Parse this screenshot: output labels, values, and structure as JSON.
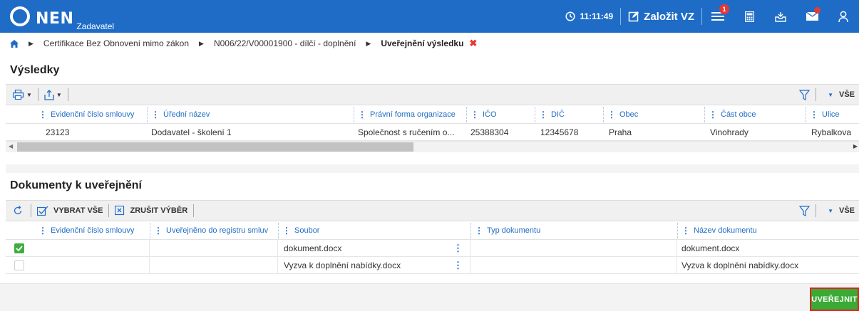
{
  "app": {
    "logo_text": "NEN",
    "logo_sub": "Zadavatel",
    "time": "11:11:49",
    "create_label": "Založit VZ",
    "menu_badge": "1",
    "accent_color": "#1f6cc7"
  },
  "breadcrumb": {
    "items": [
      "Certifikace Bez Obnovení mimo zákon",
      "N006/22/V00001900 - dílčí - doplnění"
    ],
    "current": "Uveřejnění výsledku"
  },
  "results": {
    "title": "Výsledky",
    "filter_all": "VŠE",
    "columns": [
      "Evidenční číslo smlouvy",
      "Úřední název",
      "Právní forma organizace",
      "IČO",
      "DIČ",
      "Obec",
      "Část obce",
      "Ulice"
    ],
    "rows": [
      [
        "23123",
        "Dodavatel - školení 1",
        "Společnost s ručením o...",
        "25388304",
        "12345678",
        "Praha",
        "Vinohrady",
        "Rybalkova"
      ]
    ]
  },
  "documents": {
    "title": "Dokumenty k uveřejnění",
    "select_all": "VYBRAT VŠE",
    "cancel_selection": "ZRUŠIT VÝBĚR",
    "filter_all": "VŠE",
    "columns": [
      "Evidenční číslo smlouvy",
      "Uveřejněno do registru smluv",
      "Soubor",
      "Typ dokumentu",
      "Název dokumentu"
    ],
    "rows": [
      {
        "checked": true,
        "soubor": "dokument.docx",
        "nazev": "dokument.docx"
      },
      {
        "checked": false,
        "soubor": "Vyzva k doplnění nabídky.docx",
        "nazev": "Vyzva k doplnění nabídky.docx"
      }
    ]
  },
  "actions": {
    "publish_label": "UVEŘEJNIT"
  }
}
